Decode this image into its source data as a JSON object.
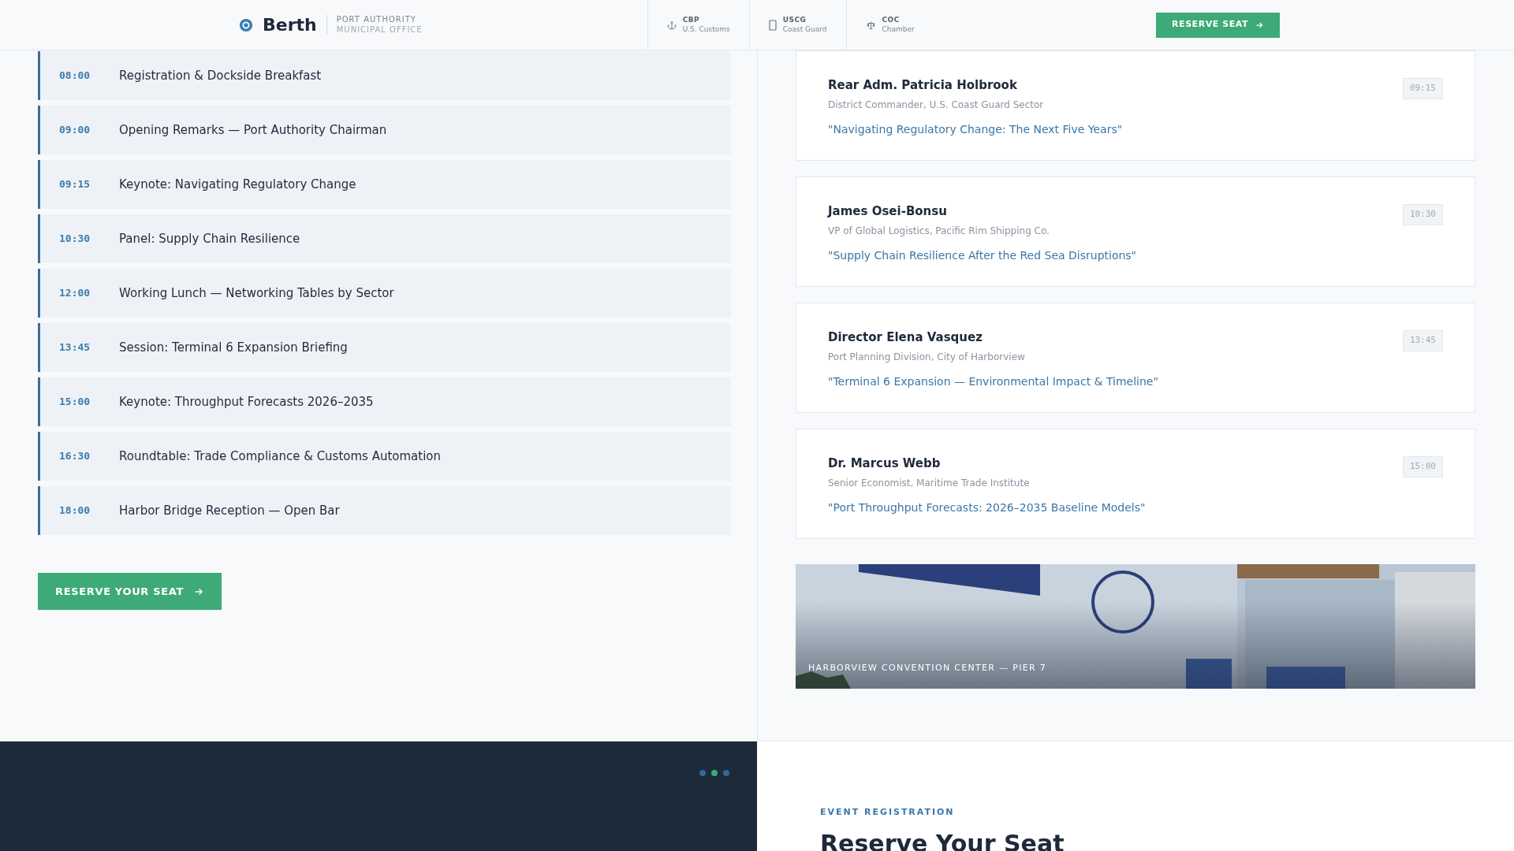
{
  "header": {
    "brand": "Berth",
    "org_line1": "PORT AUTHORITY",
    "org_line2": "MUNICIPAL OFFICE",
    "nav": [
      {
        "kind": "anchor",
        "code": "CBP",
        "label": "U.S. Customs"
      },
      {
        "kind": "badge",
        "code": "USCG",
        "label": "Coast Guard"
      },
      {
        "kind": "scale",
        "code": "COC",
        "label": "Chamber"
      }
    ],
    "cta": "RESERVE SEAT"
  },
  "schedule": [
    {
      "time": "08:00",
      "title": "Registration & Dockside Breakfast"
    },
    {
      "time": "09:00",
      "title": "Opening Remarks — Port Authority Chairman"
    },
    {
      "time": "09:15",
      "title": "Keynote: Navigating Regulatory Change"
    },
    {
      "time": "10:30",
      "title": "Panel: Supply Chain Resilience"
    },
    {
      "time": "12:00",
      "title": "Working Lunch — Networking Tables by Sector"
    },
    {
      "time": "13:45",
      "title": "Session: Terminal 6 Expansion Briefing"
    },
    {
      "time": "15:00",
      "title": "Keynote: Throughput Forecasts 2026–2035"
    },
    {
      "time": "16:30",
      "title": "Roundtable: Trade Compliance & Customs Automation"
    },
    {
      "time": "18:00",
      "title": "Harbor Bridge Reception — Open Bar"
    }
  ],
  "reserve_button": "RESERVE YOUR SEAT",
  "speakers": [
    {
      "name": "Rear Adm. Patricia Holbrook",
      "role": "District Commander, U.S. Coast Guard Sector",
      "talk": "\"Navigating Regulatory Change: The Next Five Years\"",
      "time": "09:15"
    },
    {
      "name": "James Osei-Bonsu",
      "role": "VP of Global Logistics, Pacific Rim Shipping Co.",
      "talk": "\"Supply Chain Resilience After the Red Sea Disruptions\"",
      "time": "10:30"
    },
    {
      "name": "Director Elena Vasquez",
      "role": "Port Planning Division, City of Harborview",
      "talk": "\"Terminal 6 Expansion — Environmental Impact & Timeline\"",
      "time": "13:45"
    },
    {
      "name": "Dr. Marcus Webb",
      "role": "Senior Economist, Maritime Trade Institute",
      "talk": "\"Port Throughput Forecasts: 2026–2035 Baseline Models\"",
      "time": "15:00"
    }
  ],
  "venue_photo": {
    "kind": "picture",
    "caption": "HARBORVIEW CONVENTION CENTER — PIER 7"
  },
  "carousel_dots": [
    {
      "selected": false
    },
    {
      "selected": true
    },
    {
      "selected": false
    }
  ],
  "registration": {
    "eyebrow": "EVENT REGISTRATION",
    "heading": "Reserve Your Seat"
  }
}
